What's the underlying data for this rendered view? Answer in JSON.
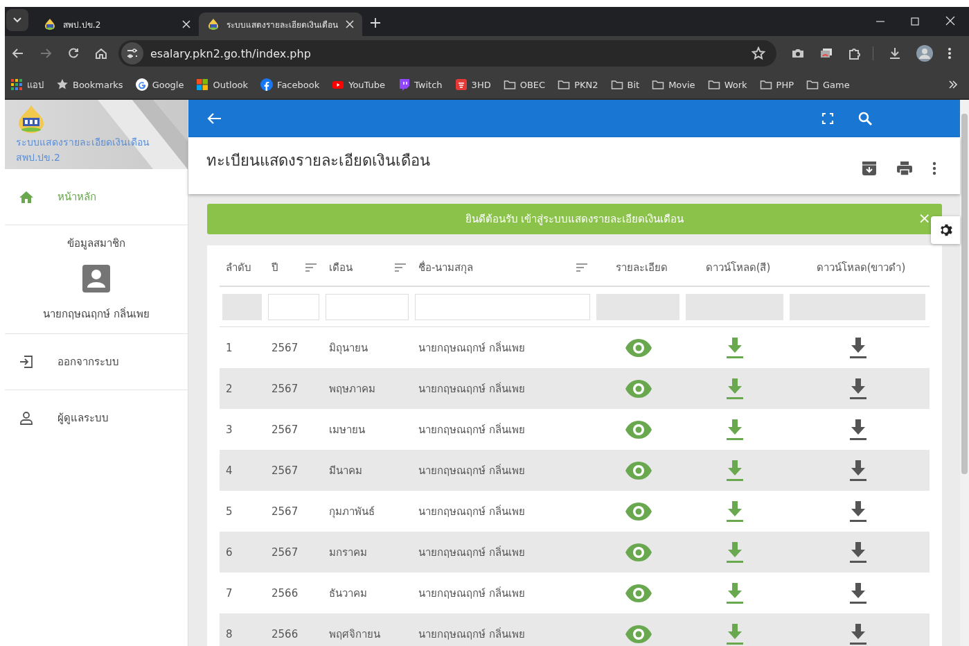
{
  "browser": {
    "tabs": [
      {
        "title": "สพป.ปข.2",
        "selected": false
      },
      {
        "title": "ระบบแสดงรายละเอียดเงินเดือน",
        "selected": true
      }
    ],
    "address": "esalary.pkn2.go.th/index.php",
    "bookmarks": [
      {
        "label": "แอป",
        "kind": "apps"
      },
      {
        "label": "Bookmarks",
        "kind": "star"
      },
      {
        "label": "Google",
        "kind": "google"
      },
      {
        "label": "Outlook",
        "kind": "outlook"
      },
      {
        "label": "Facebook",
        "kind": "facebook"
      },
      {
        "label": "YouTube",
        "kind": "youtube"
      },
      {
        "label": "Twitch",
        "kind": "twitch"
      },
      {
        "label": "3HD",
        "kind": "tv"
      },
      {
        "label": "OBEC",
        "kind": "folder"
      },
      {
        "label": "PKN2",
        "kind": "folder"
      },
      {
        "label": "Bit",
        "kind": "folder"
      },
      {
        "label": "Movie",
        "kind": "folder"
      },
      {
        "label": "Work",
        "kind": "folder"
      },
      {
        "label": "PHP",
        "kind": "folder"
      },
      {
        "label": "Game",
        "kind": "folder"
      }
    ]
  },
  "sidebar": {
    "title_lines": [
      "ระบบแสดงรายละเอียดเงินเดือน",
      "สพป.ปข.2"
    ],
    "items": [
      {
        "kind": "home",
        "label": "หน้าหลัก",
        "selected": true
      },
      {
        "kind": "profile",
        "label": "ข้อมูลสมาชิก",
        "name": "นายกฤษณฤกษ์ กลิ่นเพย"
      },
      {
        "kind": "logout",
        "label": "ออกจากระบบ",
        "selected": false
      },
      {
        "kind": "admin",
        "label": "ผู้ดูแลระบบ",
        "selected": false
      }
    ]
  },
  "page_title": "ทะเบียนแสดงรายละเอียดเงินเดือน",
  "alert": {
    "text": "ยินดีต้อนรับ เข้าสู่ระบบแสดงรายละเอียดเงินเดือน",
    "close": "×"
  },
  "table": {
    "columns": [
      {
        "label": "ลำดับ",
        "sortable": false,
        "filter_disabled": true
      },
      {
        "label": "ปี",
        "sortable": true,
        "filter_disabled": false
      },
      {
        "label": "เดือน",
        "sortable": true,
        "filter_disabled": false
      },
      {
        "label": "ชื่อ-นามสกุล",
        "sortable": true,
        "filter_disabled": false
      },
      {
        "label": "รายละเอียด",
        "sortable": false,
        "filter_disabled": true
      },
      {
        "label": "ดาวน์โหลด(สี)",
        "sortable": false,
        "filter_disabled": true
      },
      {
        "label": "ดาวน์โหลด(ขาวดำ)",
        "sortable": false,
        "filter_disabled": true
      }
    ],
    "rows": [
      [
        "1",
        "2567",
        "มิถุนายน",
        "นายกฤษณฤกษ์ กลิ่นเพย"
      ],
      [
        "2",
        "2567",
        "พฤษภาคม",
        "นายกฤษณฤกษ์ กลิ่นเพย"
      ],
      [
        "3",
        "2567",
        "เมษายน",
        "นายกฤษณฤกษ์ กลิ่นเพย"
      ],
      [
        "4",
        "2567",
        "มีนาคม",
        "นายกฤษณฤกษ์ กลิ่นเพย"
      ],
      [
        "5",
        "2567",
        "กุมภาพันธ์",
        "นายกฤษณฤกษ์ กลิ่นเพย"
      ],
      [
        "6",
        "2567",
        "มกราคม",
        "นายกฤษณฤกษ์ กลิ่นเพย"
      ],
      [
        "7",
        "2566",
        "ธันวาคม",
        "นายกฤษณฤกษ์ กลิ่นเพย"
      ],
      [
        "8",
        "2566",
        "พฤศจิกายน",
        "นายกฤษณฤกษ์ กลิ่นเพย"
      ]
    ]
  }
}
